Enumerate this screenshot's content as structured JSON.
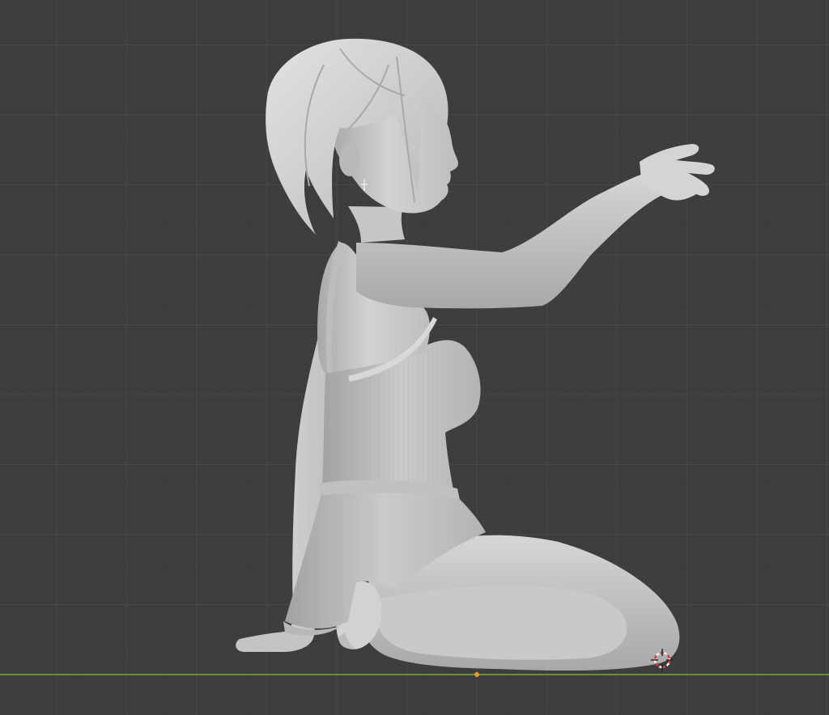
{
  "viewport": {
    "view": "orthographic-side",
    "background_color": "#3d3d3d",
    "grid_minor_color": "#454545",
    "grid_major_color": "#4c4c4c",
    "ground_axis_color": "#7aa63a",
    "mesh_base_color": "#cdcdcd",
    "mesh_shadow_color": "#9f9f9f",
    "mesh_highlight_color": "#e4e4e4",
    "origin_dot_color": "#e39a2a",
    "cursor_color_red": "#d93b3b",
    "cursor_color_white": "#f2f2f2"
  },
  "scene": {
    "object": "sculpted-figure",
    "objects": [
      "3d-cursor-icon",
      "origin-point-icon"
    ]
  }
}
